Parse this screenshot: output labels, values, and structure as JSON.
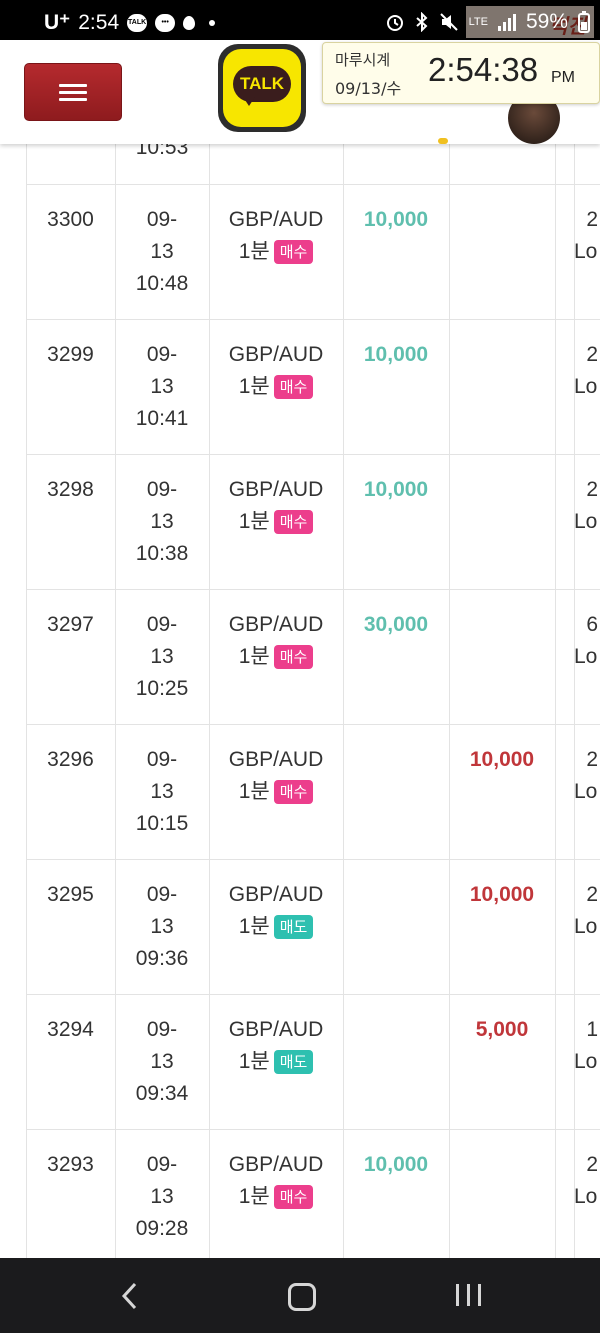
{
  "statusbar": {
    "carrier": "U⁺",
    "time": "2:54",
    "talk_icon": "TALK",
    "network": "LTE",
    "battery": "59%",
    "watermark": "먹진"
  },
  "header": {
    "talk_label": "TALK",
    "clock": {
      "label": "마루시계",
      "date": "09/13/수",
      "time": "2:54:38",
      "ampm": "PM"
    }
  },
  "table": {
    "partial_top_time": "10:53",
    "rows": [
      {
        "id": "3300",
        "date_line1": "09-",
        "date_line2": "13",
        "time": "10:48",
        "symbol": "GBP/AUD",
        "timeframe": "1분",
        "side": "매수",
        "side_type": "buy",
        "win": "10,000",
        "lose": "",
        "last1": "2",
        "last2": "Lo"
      },
      {
        "id": "3299",
        "date_line1": "09-",
        "date_line2": "13",
        "time": "10:41",
        "symbol": "GBP/AUD",
        "timeframe": "1분",
        "side": "매수",
        "side_type": "buy",
        "win": "10,000",
        "lose": "",
        "last1": "2",
        "last2": "Lo"
      },
      {
        "id": "3298",
        "date_line1": "09-",
        "date_line2": "13",
        "time": "10:38",
        "symbol": "GBP/AUD",
        "timeframe": "1분",
        "side": "매수",
        "side_type": "buy",
        "win": "10,000",
        "lose": "",
        "last1": "2",
        "last2": "Lo"
      },
      {
        "id": "3297",
        "date_line1": "09-",
        "date_line2": "13",
        "time": "10:25",
        "symbol": "GBP/AUD",
        "timeframe": "1분",
        "side": "매수",
        "side_type": "buy",
        "win": "30,000",
        "lose": "",
        "last1": "6",
        "last2": "Lo"
      },
      {
        "id": "3296",
        "date_line1": "09-",
        "date_line2": "13",
        "time": "10:15",
        "symbol": "GBP/AUD",
        "timeframe": "1분",
        "side": "매수",
        "side_type": "buy",
        "win": "",
        "lose": "10,000",
        "last1": "2",
        "last2": "Lo"
      },
      {
        "id": "3295",
        "date_line1": "09-",
        "date_line2": "13",
        "time": "09:36",
        "symbol": "GBP/AUD",
        "timeframe": "1분",
        "side": "매도",
        "side_type": "sell",
        "win": "",
        "lose": "10,000",
        "last1": "2",
        "last2": "Lo"
      },
      {
        "id": "3294",
        "date_line1": "09-",
        "date_line2": "13",
        "time": "09:34",
        "symbol": "GBP/AUD",
        "timeframe": "1분",
        "side": "매도",
        "side_type": "sell",
        "win": "",
        "lose": "5,000",
        "last1": "1",
        "last2": "Lo"
      },
      {
        "id": "3293",
        "date_line1": "09-",
        "date_line2": "13",
        "time": "09:28",
        "symbol": "GBP/AUD",
        "timeframe": "1분",
        "side": "매수",
        "side_type": "buy",
        "win": "10,000",
        "lose": "",
        "last1": "2",
        "last2": "Lo"
      }
    ]
  },
  "colors": {
    "menu_button": "#a82327",
    "buy_badge": "#ec3e8c",
    "sell_badge": "#2ec0b0",
    "win_text": "#5fbfae",
    "lose_text": "#c0363a"
  },
  "icons": {
    "menu": "hamburger-icon",
    "kakao": "kakao-talk-icon",
    "back": "back-icon",
    "home": "home-icon",
    "recent": "recent-apps-icon"
  }
}
